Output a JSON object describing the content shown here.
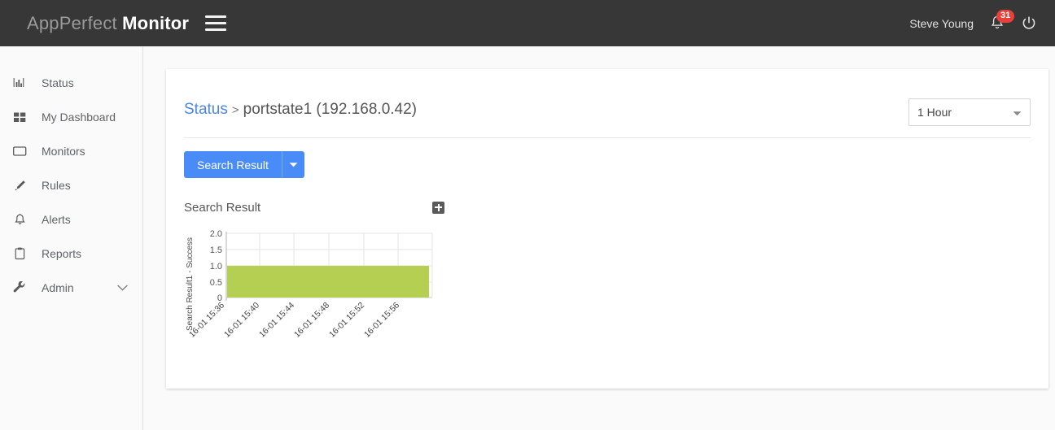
{
  "header": {
    "brand_light": "AppPerfect",
    "brand_bold": "Monitor",
    "menu_icon": "hamburger-icon",
    "username": "Steve Young",
    "notification_count": "31",
    "notification_icon": "bell-icon",
    "power_icon": "power-icon",
    "bg_color": "#373737",
    "badge_color": "#e8413a"
  },
  "sidebar": {
    "items": [
      {
        "label": "Status",
        "icon": "bar-chart-icon"
      },
      {
        "label": "My Dashboard",
        "icon": "grid-icon"
      },
      {
        "label": "Monitors",
        "icon": "monitor-icon"
      },
      {
        "label": "Rules",
        "icon": "pencil-icon"
      },
      {
        "label": "Alerts",
        "icon": "bell-icon"
      },
      {
        "label": "Reports",
        "icon": "clipboard-icon"
      },
      {
        "label": "Admin",
        "icon": "wrench-icon",
        "chevron": "chevron-down-icon"
      }
    ]
  },
  "main": {
    "breadcrumb": {
      "link": "Status",
      "separator": ">",
      "current": "portstate1 (192.168.0.42)",
      "link_color": "#4a86e8"
    },
    "time_range": {
      "selected": "1 Hour",
      "caret": "chevron-down-icon"
    },
    "action_button": {
      "label": "Search Result",
      "caret": "chevron-down-icon",
      "color": "#4a8cf7"
    },
    "panel": {
      "title": "Search Result",
      "expand_icon": "plus-square-icon"
    }
  },
  "chart_data": {
    "type": "area",
    "title": "Search Result",
    "xlabel": "",
    "ylabel": "Search Result1 - Success",
    "x": [
      "16-01 15:36",
      "16-01 15:40",
      "16-01 15:44",
      "16-01 15:48",
      "16-01 15:52",
      "16-01 15:56"
    ],
    "yticks": [
      "0",
      "0.5",
      "1.0",
      "1.5",
      "2.0"
    ],
    "ylim": [
      0,
      2
    ],
    "series": [
      {
        "name": "Search Result1 - Success",
        "values": [
          1,
          1,
          1,
          1,
          1,
          1
        ],
        "color": "#b5cf52"
      }
    ],
    "grid": true,
    "legend": "none"
  }
}
